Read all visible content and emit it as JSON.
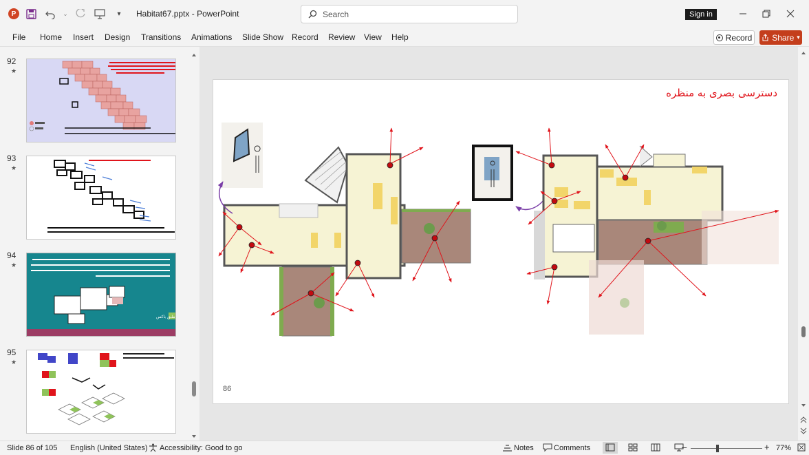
{
  "window": {
    "title": "Habitat67.pptx",
    "app_name": "PowerPoint",
    "app_badge": "P",
    "search_placeholder": "Search",
    "signin_label": "Sign in"
  },
  "ribbon": {
    "tabs": [
      "File",
      "Home",
      "Insert",
      "Design",
      "Transitions",
      "Animations",
      "Slide Show",
      "Record",
      "Review",
      "View",
      "Help"
    ],
    "record_label": "Record",
    "share_label": "Share"
  },
  "slides_panel": {
    "items": [
      {
        "number": "92"
      },
      {
        "number": "93"
      },
      {
        "number": "94",
        "caption": "طبق باکس"
      },
      {
        "number": "95"
      }
    ]
  },
  "slide": {
    "title": "دسترسی بصری به منظره",
    "page_number": "86"
  },
  "status": {
    "slide_info": "Slide 86 of 105",
    "language": "English (United States)",
    "accessibility": "Accessibility: Good to go",
    "notes_label": "Notes",
    "comments_label": "Comments",
    "zoom": "77%",
    "zoom_level": 0.77
  },
  "colors": {
    "accent": "#c43e1c",
    "title_red": "#e0141b",
    "thumb_teal": "#16868e"
  }
}
